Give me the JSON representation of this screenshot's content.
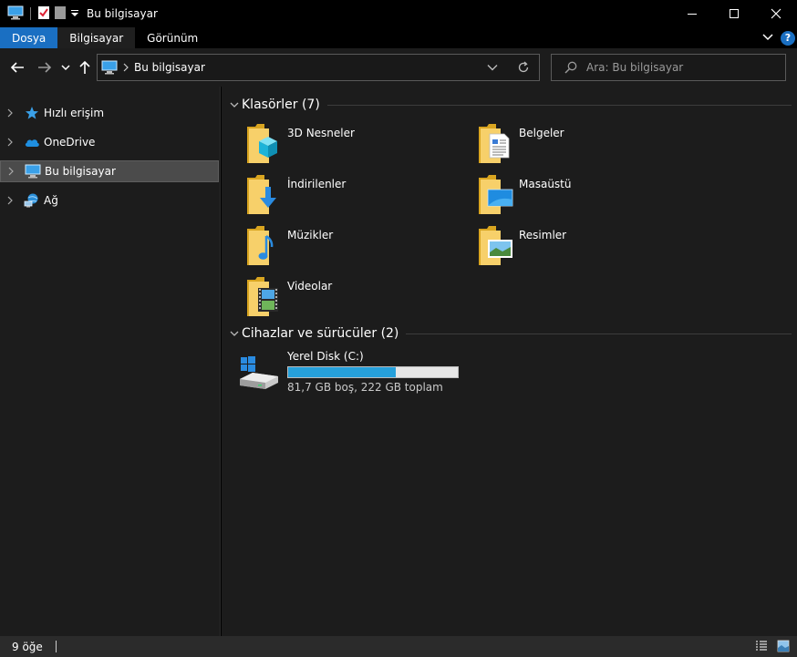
{
  "window": {
    "title": "Bu bilgisayar",
    "controls": [
      "minimize",
      "maximize",
      "close"
    ]
  },
  "ribbon": {
    "tabs": [
      {
        "label": "Dosya"
      },
      {
        "label": "Bilgisayar"
      },
      {
        "label": "Görünüm"
      }
    ],
    "help": "?"
  },
  "navigation": {
    "breadcrumb": [
      "Bu bilgisayar"
    ],
    "search_placeholder": "Ara: Bu bilgisayar"
  },
  "sidebar": {
    "items": [
      {
        "label": "Hızlı erişim",
        "icon": "star-icon"
      },
      {
        "label": "OneDrive",
        "icon": "cloud-icon"
      },
      {
        "label": "Bu bilgisayar",
        "icon": "computer-icon",
        "selected": true
      },
      {
        "label": "Ağ",
        "icon": "network-icon"
      }
    ]
  },
  "main": {
    "folders_header": "Klasörler (7)",
    "folders": [
      {
        "label": "3D Nesneler",
        "icon": "3d-objects-folder-icon"
      },
      {
        "label": "Belgeler",
        "icon": "documents-folder-icon"
      },
      {
        "label": "İndirilenler",
        "icon": "downloads-folder-icon"
      },
      {
        "label": "Masaüstü",
        "icon": "desktop-folder-icon"
      },
      {
        "label": "Müzikler",
        "icon": "music-folder-icon"
      },
      {
        "label": "Resimler",
        "icon": "pictures-folder-icon"
      },
      {
        "label": "Videolar",
        "icon": "videos-folder-icon"
      }
    ],
    "drives_header": "Cihazlar ve sürücüler (2)",
    "drives": [
      {
        "label": "Yerel Disk (C:)",
        "free_text": "81,7 GB boş, 222 GB toplam",
        "used_fraction": 0.632
      }
    ]
  },
  "statusbar": {
    "item_count": "9 öğe"
  },
  "colors": {
    "accent": "#1a6fc2",
    "drive_bar": "#26a0da",
    "folder": "#f5c342"
  }
}
